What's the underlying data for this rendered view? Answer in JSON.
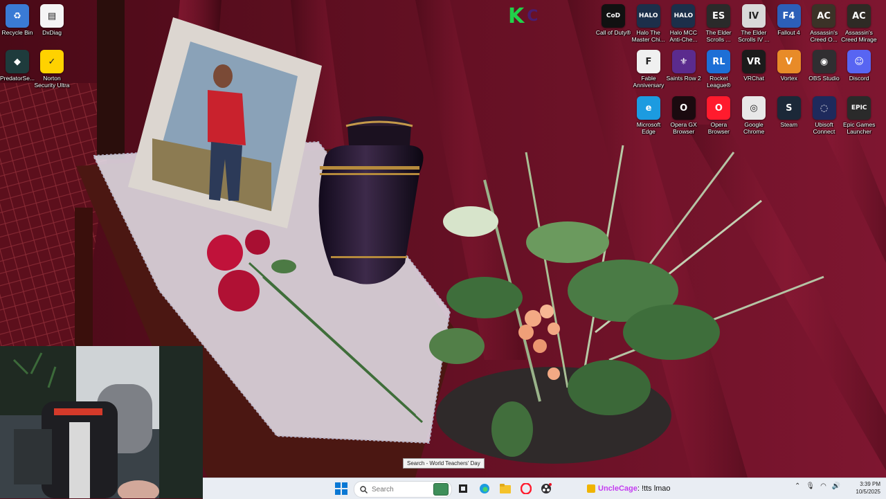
{
  "desktop": {
    "icons_left": [
      {
        "label": "Recycle Bin",
        "glyph": "♻",
        "icon": "recycle-bin-icon",
        "bg": "#3a7bd5"
      },
      {
        "label": "DxDiag",
        "glyph": "▤",
        "icon": "document-icon",
        "bg": "#f5f5f5"
      },
      {
        "label": "PredatorSe...",
        "glyph": "◆",
        "icon": "predator-icon",
        "bg": "#1e3b3c"
      },
      {
        "label": "Norton Security Ultra",
        "glyph": "✓",
        "icon": "norton-icon",
        "bg": "#ffd200"
      }
    ],
    "icons_right_row1": [
      {
        "label": "Call of Duty®",
        "glyph": "CoD",
        "icon": "call-of-duty-icon",
        "bg": "#111111"
      },
      {
        "label": "Halo The Master Chi...",
        "glyph": "HALO",
        "icon": "halo-mcc-icon",
        "bg": "#1c2f4a"
      },
      {
        "label": "Halo MCC Anti-Che...",
        "glyph": "HALO",
        "icon": "halo-anticheat-icon",
        "bg": "#1c2f4a"
      },
      {
        "label": "The Elder Scrolls ...",
        "glyph": "ES",
        "icon": "elder-scrolls-icon",
        "bg": "#2a2a2a"
      },
      {
        "label": "The Elder Scrolls IV ...",
        "glyph": "IV",
        "icon": "oblivion-icon",
        "bg": "#d9d9d9"
      },
      {
        "label": "Fallout 4",
        "glyph": "F4",
        "icon": "fallout-icon",
        "bg": "#2c5fb8"
      },
      {
        "label": "Assassin's Creed O...",
        "glyph": "AC",
        "icon": "assassins-creed-origins-icon",
        "bg": "#3b3227"
      },
      {
        "label": "Assassin's Creed Mirage",
        "glyph": "AC",
        "icon": "assassins-creed-mirage-icon",
        "bg": "#2e2a25"
      }
    ],
    "icons_right_row2": [
      {
        "label": "Fable Anniversary",
        "glyph": "F",
        "icon": "fable-icon",
        "bg": "#f0f0f0"
      },
      {
        "label": "Saints Row 2",
        "glyph": "⚜",
        "icon": "saints-row-icon",
        "bg": "#5b2b8e"
      },
      {
        "label": "Rocket League®",
        "glyph": "RL",
        "icon": "rocket-league-icon",
        "bg": "#1d6fd6"
      },
      {
        "label": "VRChat",
        "glyph": "VR",
        "icon": "vrchat-icon",
        "bg": "#1b1b1b"
      },
      {
        "label": "Vortex",
        "glyph": "V",
        "icon": "vortex-icon",
        "bg": "#e88b28"
      },
      {
        "label": "OBS Studio",
        "glyph": "◉",
        "icon": "obs-icon",
        "bg": "#302e31"
      },
      {
        "label": "Discord",
        "glyph": "☺",
        "icon": "discord-icon",
        "bg": "#5865f2"
      }
    ],
    "icons_right_row3": [
      {
        "label": "Microsoft Edge",
        "glyph": "e",
        "icon": "edge-icon",
        "bg": "#1c9be0"
      },
      {
        "label": "Opera GX Browser",
        "glyph": "O",
        "icon": "opera-gx-icon",
        "bg": "#1a0a0f"
      },
      {
        "label": "Opera Browser",
        "glyph": "O",
        "icon": "opera-icon",
        "bg": "#ff1b2d"
      },
      {
        "label": "Google Chrome",
        "glyph": "◎",
        "icon": "chrome-icon",
        "bg": "#e8e8e8"
      },
      {
        "label": "Steam",
        "glyph": "S",
        "icon": "steam-icon",
        "bg": "#1b2838"
      },
      {
        "label": "Ubisoft Connect",
        "glyph": "◌",
        "icon": "ubisoft-icon",
        "bg": "#1e2a5c"
      },
      {
        "label": "Epic Games Launcher",
        "glyph": "EPIC",
        "icon": "epic-games-icon",
        "bg": "#2a2a2a"
      }
    ]
  },
  "overlay": {
    "k_letter": "K",
    "c_letter": "C"
  },
  "tooltip": "Search - World Teachers' Day",
  "taskbar": {
    "search_placeholder": "Search",
    "chat_user": "UncleCage",
    "chat_text": ": !tts lmao",
    "time": "3:39 PM",
    "date": "10/5/2025"
  },
  "colors": {
    "curtain": "#7a1428",
    "taskbar_bg": "#e9edf3",
    "accent": "#0067c0"
  }
}
